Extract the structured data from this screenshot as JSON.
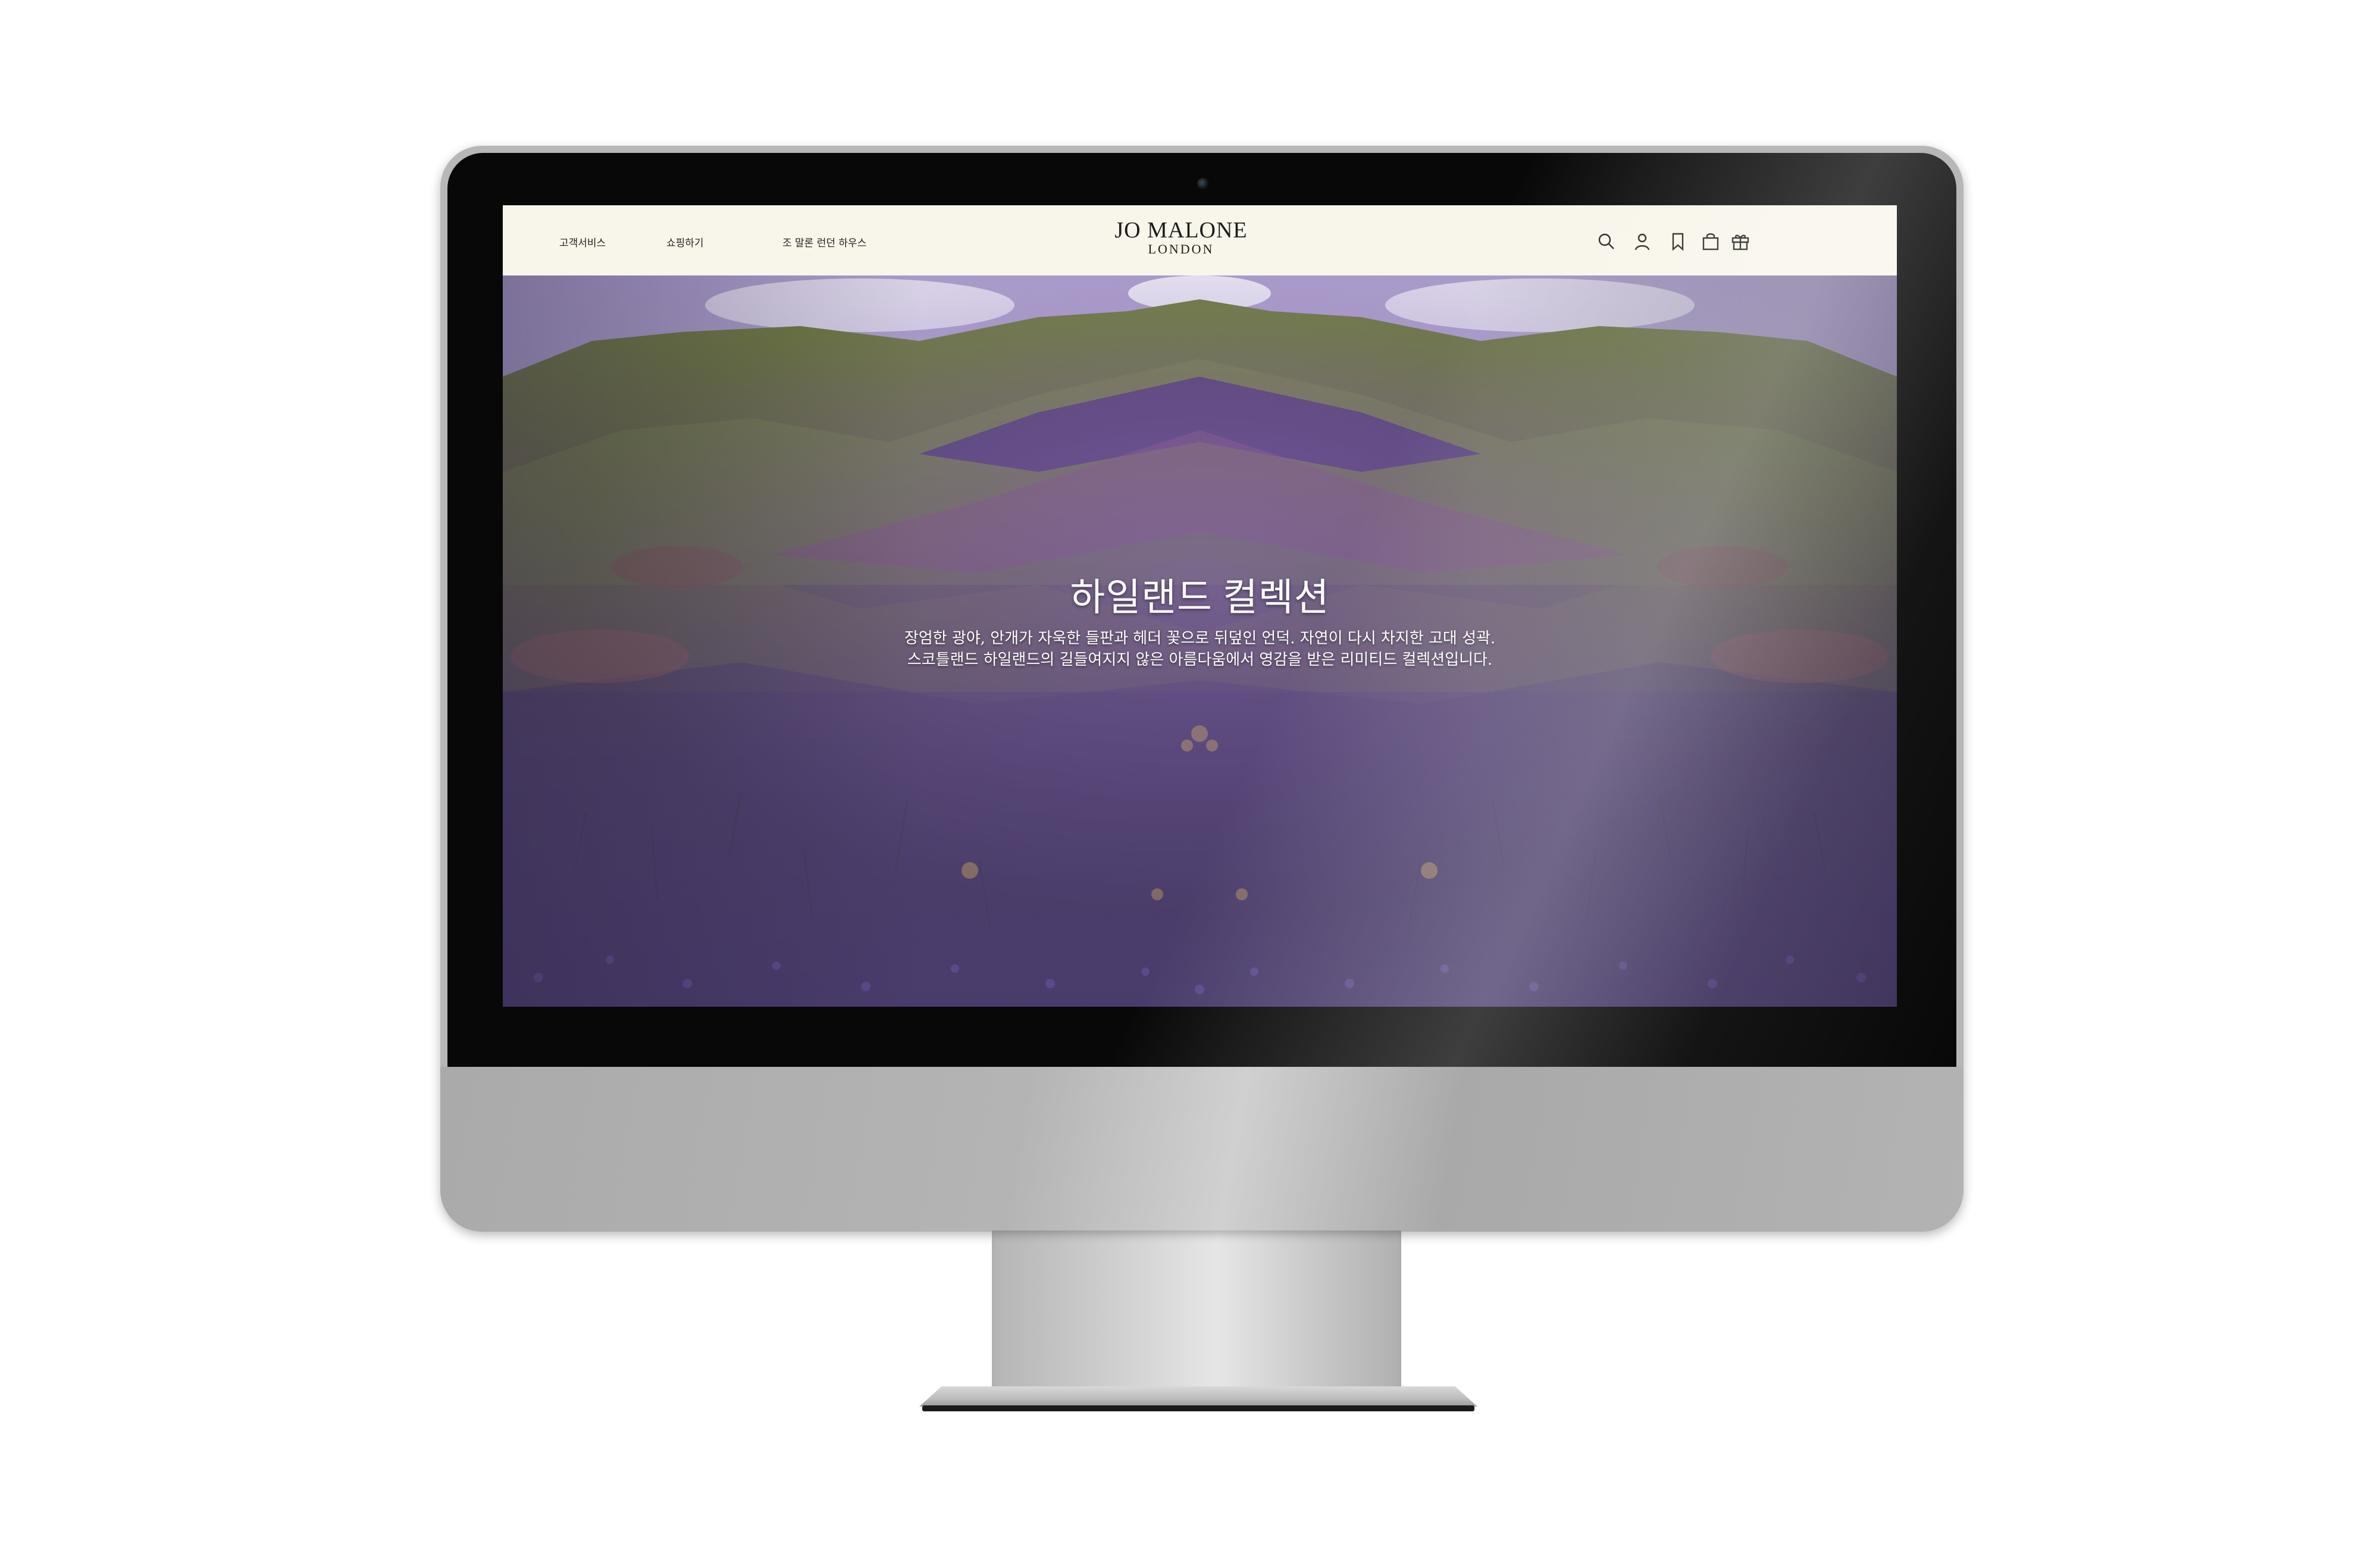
{
  "header": {
    "nav": [
      {
        "label": "고객서비스"
      },
      {
        "label": "쇼핑하기"
      },
      {
        "label": "조 말론 런던 하우스"
      }
    ],
    "brand": {
      "name": "JO MALONE",
      "sub": "LONDON"
    },
    "icons": [
      "search-icon",
      "account-icon",
      "wishlist-icon",
      "shopping-bag-icon",
      "gift-icon"
    ]
  },
  "hero": {
    "title": "하일랜드 컬렉션",
    "desc_line1": "장엄한 광야, 안개가 자욱한 들판과 헤더 꽃으로 뒤덮인 언덕. 자연이 다시 차지한 고대 성곽.",
    "desc_line2": "스코틀랜드 하일랜드의 길들여지지 않은 아름다움에서 영감을 받은 리미티드 컬렉션입니다."
  },
  "colors": {
    "header_bg": "#f8f5ea",
    "heather": "#6b4f9a",
    "moss": "#6f8a3e",
    "sky": "#c9d4e6"
  }
}
